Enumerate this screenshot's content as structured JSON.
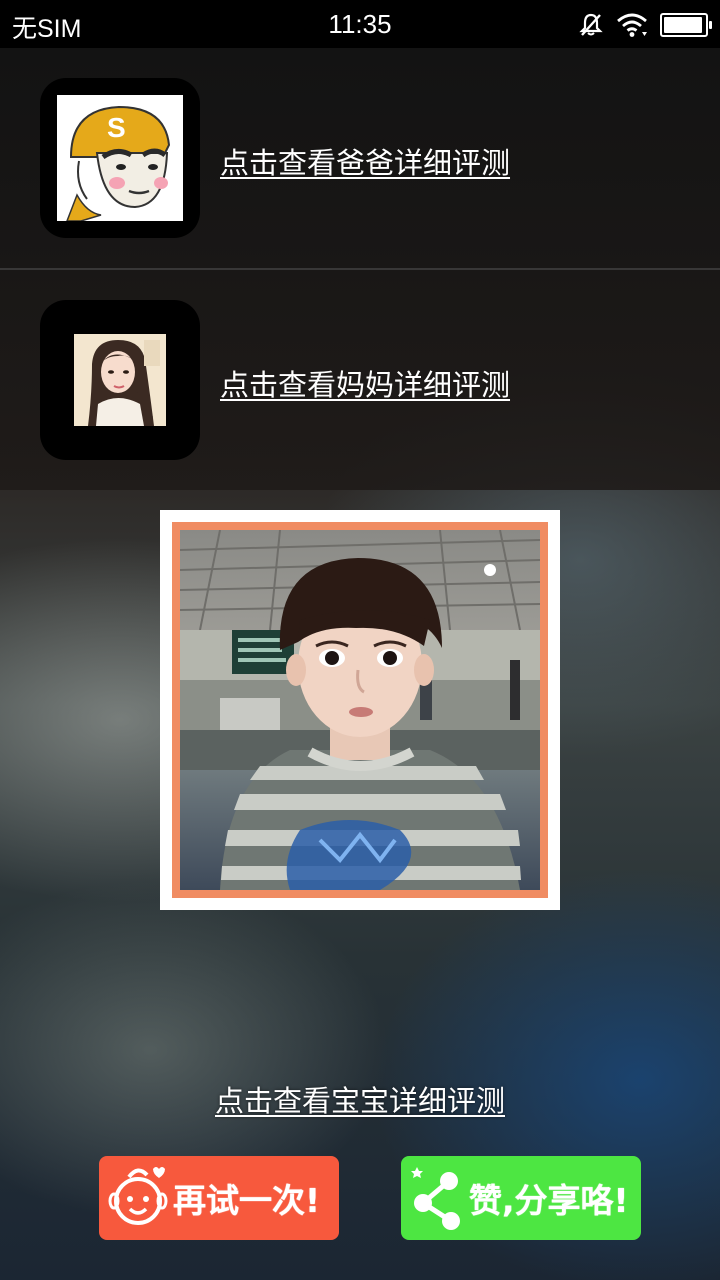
{
  "status_bar": {
    "carrier": "无SIM",
    "time": "11:35",
    "battery_level": 0.95,
    "icons": [
      "mute-bell-icon",
      "wifi-icon",
      "battery-icon"
    ]
  },
  "rows": [
    {
      "link": "点击查看爸爸详细评测",
      "avatar_icon": "dad-cartoon-avatar"
    },
    {
      "link": "点击查看妈妈详细评测",
      "avatar_icon": "mom-illustration-avatar"
    }
  ],
  "baby": {
    "photo_icon": "baby-photo",
    "link": "点击查看宝宝详细评测"
  },
  "buttons": {
    "retry_label": "再试一次!",
    "retry_icon": "baby-face-icon",
    "retry_color": "#f7593d",
    "share_label": "赞,分享咯!",
    "share_icon": "share-icon",
    "share_color": "#4de642"
  },
  "colors": {
    "photo_border": "#f08c62",
    "avatar_box": "#000000"
  }
}
